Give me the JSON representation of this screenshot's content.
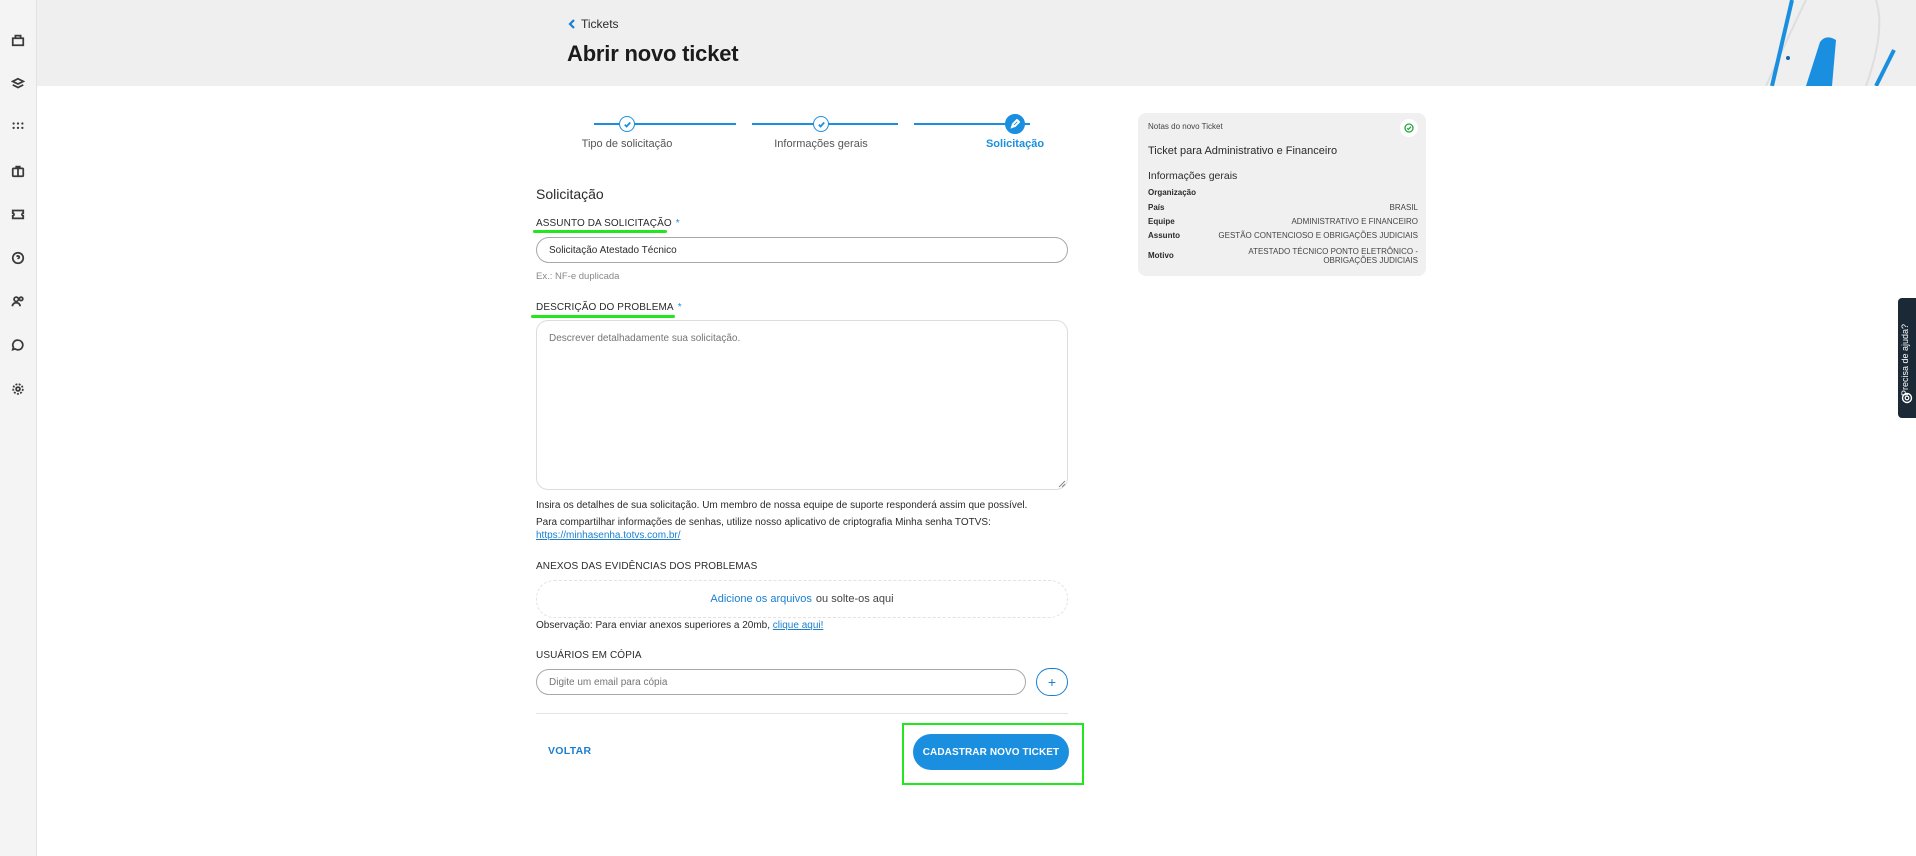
{
  "header": {
    "back_label": "Tickets",
    "title": "Abrir novo ticket"
  },
  "stepper": {
    "steps": [
      {
        "label": "Tipo de solicitação",
        "state": "done"
      },
      {
        "label": "Informações gerais",
        "state": "done"
      },
      {
        "label": "Solicitação",
        "state": "active"
      }
    ]
  },
  "form": {
    "section_title": "Solicitação",
    "subject": {
      "label": "ASSUNTO DA SOLICITAÇÃO",
      "required_mark": "*",
      "value": "Solicitação Atestado Técnico",
      "helper": "Ex.: NF-e duplicada"
    },
    "description": {
      "label": "DESCRIÇÃO DO PROBLEMA",
      "required_mark": "*",
      "placeholder": "Descrever detalhadamente sua solicitação."
    },
    "info_line": "Insira os detalhes de sua solicitação. Um membro de nossa equipe de suporte responderá assim que possível.",
    "password_line": "Para compartilhar informações de senhas, utilize nosso aplicativo de criptografia Minha senha TOTVS:",
    "password_link": "https://minhasenha.totvs.com.br/",
    "attachments": {
      "label": "ANEXOS DAS EVIDÊNCIAS DOS PROBLEMAS",
      "add_link": "Adicione os arquivos",
      "drop_text": "ou solte-os aqui",
      "note": "Observação: Para enviar anexos superiores a 20mb,",
      "note_link": "clique aqui!"
    },
    "cc": {
      "label": "USUÁRIOS EM CÓPIA",
      "placeholder": "Digite um email para cópia",
      "add_label": "+"
    },
    "back_label": "VOLTAR",
    "submit_label": "CADASTRAR NOVO TICKET"
  },
  "notes": {
    "header": "Notas do novo Ticket",
    "title": "Ticket para Administrativo e Financeiro",
    "section": "Informações gerais",
    "rows": [
      {
        "k": "Organização",
        "v": ""
      },
      {
        "k": "País",
        "v": "BRASIL"
      },
      {
        "k": "Equipe",
        "v": "ADMINISTRATIVO E FINANCEIRO"
      },
      {
        "k": "Assunto",
        "v": "GESTÃO CONTENCIOSO E OBRIGAÇÕES JUDICIAIS"
      },
      {
        "k": "Motivo",
        "v": "ATESTADO TÉCNICO PONTO ELETRÔNICO - OBRIGAÇÕES JUDICIAIS"
      }
    ]
  },
  "help_tab": {
    "label": "Precisa de ajuda?"
  },
  "colors": {
    "accent": "#1a8fe0",
    "link": "#1a7fd1",
    "highlight": "#22e61e",
    "help_bg": "#1b2836"
  },
  "sidebar": {
    "icons": [
      "building-icon",
      "layers-icon",
      "grid-icon",
      "briefcase-icon",
      "ticket-icon",
      "help-circle-icon",
      "users-icon",
      "chat-icon",
      "settings-icon"
    ]
  }
}
